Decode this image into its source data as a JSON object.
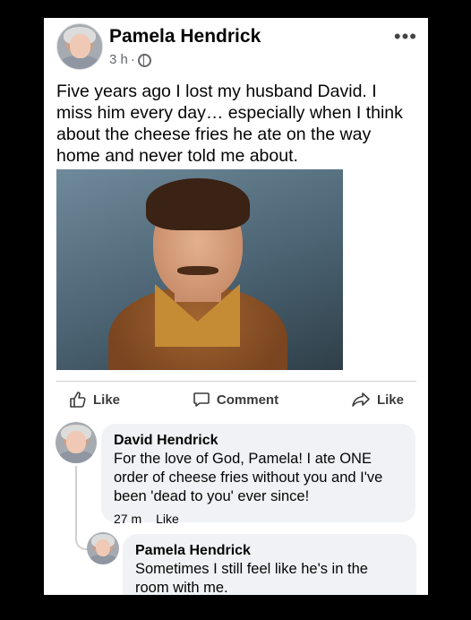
{
  "post": {
    "author": "Pamela Hendrick",
    "time": "3 h",
    "separator": "·",
    "more_label": "•••",
    "text": "Five years ago I lost my husband David. I miss him every day… especially when I think about the cheese fries he ate on the way home and never told me about."
  },
  "actions": {
    "like_label": "Like",
    "comment_label": "Comment",
    "share_label": "Like"
  },
  "comments": [
    {
      "name": "David Hendrick",
      "text": "For the love of God, Pamela! I ate ONE order of cheese fries without you and I've been 'dead to you' ever since!",
      "time": "27 m",
      "like_label": "Like"
    },
    {
      "name": "Pamela Hendrick",
      "text": "Sometimes I still feel like he's in the room with me."
    }
  ],
  "colors": {
    "background": "#000000",
    "card": "#ffffff",
    "comment_bubble": "#f0f2f5",
    "secondary_text": "#65676b"
  },
  "icons": [
    "globe-icon",
    "more-icon",
    "like-icon",
    "comment-icon",
    "share-icon"
  ]
}
